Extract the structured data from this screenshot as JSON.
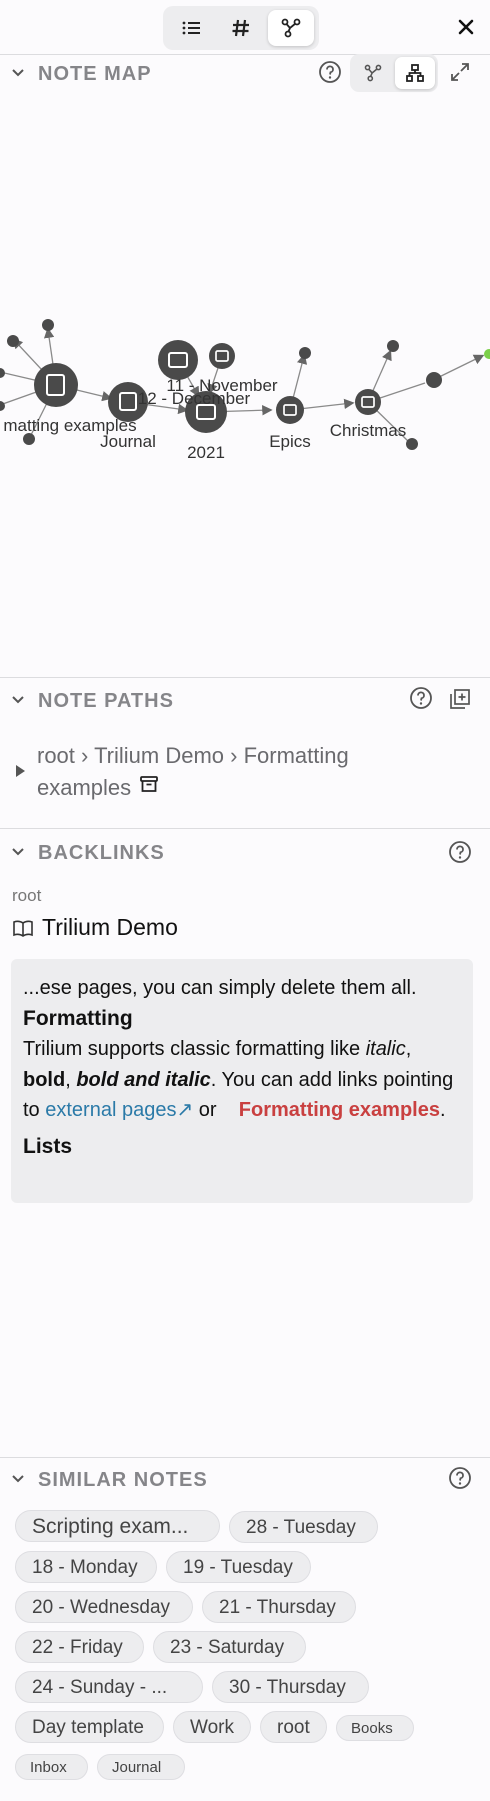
{
  "toolbar": {
    "tabs": [
      {
        "icon": "list-icon",
        "active": false
      },
      {
        "icon": "hash-icon",
        "active": false
      },
      {
        "icon": "graph-icon",
        "active": true
      }
    ],
    "close_icon": "close-icon"
  },
  "note_map": {
    "title": "NOTE MAP",
    "help_icon": "help-icon",
    "mode_buttons": [
      {
        "icon": "link-map-icon",
        "active": false
      },
      {
        "icon": "tree-map-icon",
        "active": true
      }
    ],
    "fullscreen_icon": "fullscreen-icon",
    "labels": {
      "formatting_examples": "matting examples",
      "journal": "Journal",
      "nov": "11 - November",
      "dec": "12 - December",
      "y2021": "2021",
      "epics": "Epics",
      "christmas": "Christmas"
    }
  },
  "note_paths": {
    "title": "NOTE PATHS",
    "help_icon": "help-icon",
    "clone_icon": "clone-icon",
    "path": {
      "line1": "root › Trilium Demo › Formatting",
      "line2": "examples",
      "archive_icon": "archive-icon"
    }
  },
  "backlinks": {
    "title": "BACKLINKS",
    "help_icon": "help-icon",
    "item": {
      "parent": "root",
      "title": "Trilium Demo",
      "icon": "book-icon",
      "excerpt": {
        "line1": "...ese pages, you can simply delete them all.",
        "heading1": "Formatting",
        "p1_a": "Trilium supports classic formatting like ",
        "p1_italic": "italic",
        "p1_b": ",",
        "p1_bold": "bold",
        "p1_c": ", ",
        "p1_bold_italic": "bold and italic",
        "p1_d": ". You can add links pointing to ",
        "p1_ext_link": "external pages↗",
        "p1_e": " or ",
        "p1_int_link": "Formatting examples",
        "p1_f": ".",
        "heading2": "Lists"
      }
    }
  },
  "similar_notes": {
    "title": "SIMILAR NOTES",
    "help_icon": "help-icon",
    "chips": [
      {
        "label": "Scripting exam..."
      },
      {
        "label": "28 - Tuesday"
      },
      {
        "label": "18 - Monday"
      },
      {
        "label": "19 - Tuesday"
      },
      {
        "label": "20 - Wednesday"
      },
      {
        "label": "21 - Thursday"
      },
      {
        "label": "22 - Friday"
      },
      {
        "label": "23 - Saturday"
      },
      {
        "label": "24 - Sunday - ..."
      },
      {
        "label": "30 - Thursday"
      },
      {
        "label": "Day template"
      },
      {
        "label": "Work"
      },
      {
        "label": "root"
      },
      {
        "label": "Books"
      },
      {
        "label": "Inbox"
      },
      {
        "label": "Journal"
      }
    ]
  }
}
